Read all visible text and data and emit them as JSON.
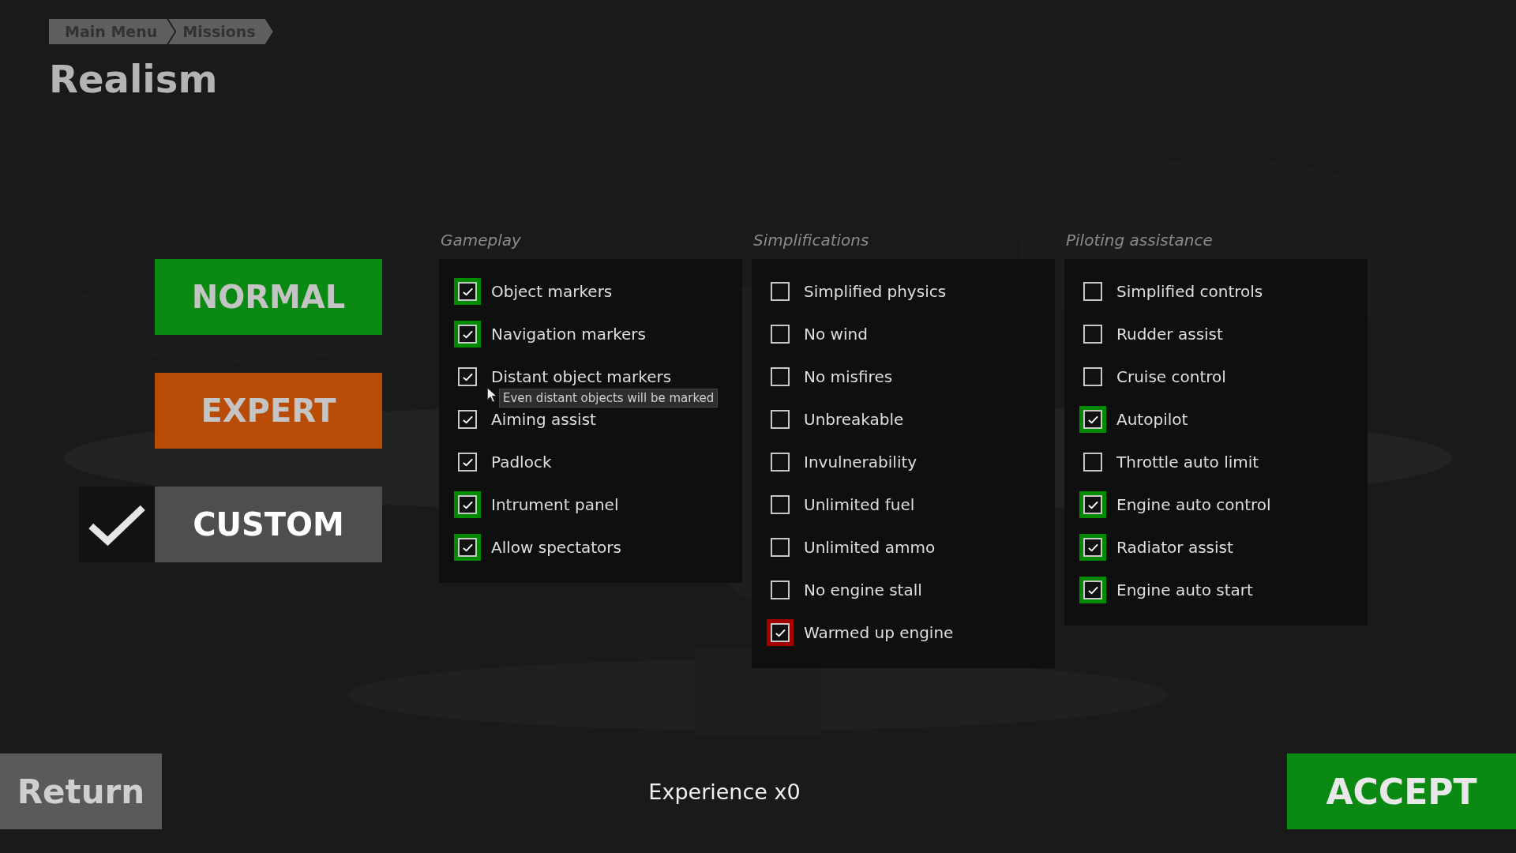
{
  "breadcrumb": [
    {
      "label": "Main Menu"
    },
    {
      "label": "Missions"
    }
  ],
  "title": "Realism",
  "presets": [
    {
      "label": "NORMAL",
      "color": "#0a8a12",
      "selected": false
    },
    {
      "label": "EXPERT",
      "color": "#b84c06",
      "selected": false
    },
    {
      "label": "CUSTOM",
      "color": "#4e4e4e",
      "selected": true
    }
  ],
  "groups": [
    {
      "title": "Gameplay",
      "options": [
        {
          "label": "Object markers",
          "checked": true,
          "color": "#008a00"
        },
        {
          "label": "Navigation markers",
          "checked": true,
          "color": "#008a00"
        },
        {
          "label": "Distant object markers",
          "checked": true,
          "tooltip": "Even distant objects will be marked"
        },
        {
          "label": "Aiming assist",
          "checked": true
        },
        {
          "label": "Padlock",
          "checked": true
        },
        {
          "label": "Intrument panel",
          "checked": true,
          "color": "#008a00"
        },
        {
          "label": "Allow spectators",
          "checked": true,
          "color": "#008a00"
        }
      ]
    },
    {
      "title": "Simplifications",
      "options": [
        {
          "label": "Simplified physics",
          "checked": false
        },
        {
          "label": "No wind",
          "checked": false
        },
        {
          "label": "No misfires",
          "checked": false
        },
        {
          "label": "Unbreakable",
          "checked": false
        },
        {
          "label": "Invulnerability",
          "checked": false
        },
        {
          "label": "Unlimited fuel",
          "checked": false
        },
        {
          "label": "Unlimited ammo",
          "checked": false
        },
        {
          "label": "No engine stall",
          "checked": false
        },
        {
          "label": "Warmed up engine",
          "checked": true,
          "color": "#a40000"
        }
      ]
    },
    {
      "title": "Piloting assistance",
      "options": [
        {
          "label": "Simplified controls",
          "checked": false
        },
        {
          "label": "Rudder assist",
          "checked": false
        },
        {
          "label": "Cruise control",
          "checked": false
        },
        {
          "label": "Autopilot",
          "checked": true,
          "color": "#008a00"
        },
        {
          "label": "Throttle auto limit",
          "checked": false
        },
        {
          "label": "Engine auto control",
          "checked": true,
          "color": "#008a00"
        },
        {
          "label": "Radiator assist",
          "checked": true,
          "color": "#008a00"
        },
        {
          "label": "Engine auto start",
          "checked": true,
          "color": "#008a00"
        }
      ]
    }
  ],
  "return_button": "Return",
  "experience": "Experience x0",
  "accept_button": "ACCEPT"
}
